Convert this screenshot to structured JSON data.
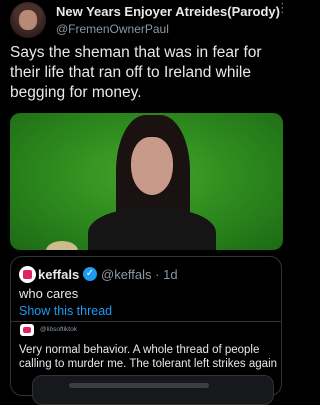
{
  "tweet": {
    "display_name": "New Years Enjoyer Atreides(Parody)",
    "handle": "@FremenOwnerPaul",
    "text": "Says the sheman that was in fear for their life that ran off to Ireland while begging for money.",
    "more_icon": "more-vertical-icon"
  },
  "quote": {
    "name": "keffals",
    "verified_icon": "verified-badge-icon",
    "handle_time": "@keffals · 1d",
    "body": "who cares",
    "show_thread": "Show this thread",
    "inner": {
      "handle": "@libsoftiktok",
      "text": "Very normal behavior. A whole thread of people calling to murder me. The tolerant left strikes again"
    }
  },
  "colors": {
    "background": "#000000",
    "text": "#e7e9ea",
    "muted": "#8b98a5",
    "link": "#1d9bf0",
    "border": "#2f3336",
    "green_screen": "#2f8d1f"
  }
}
